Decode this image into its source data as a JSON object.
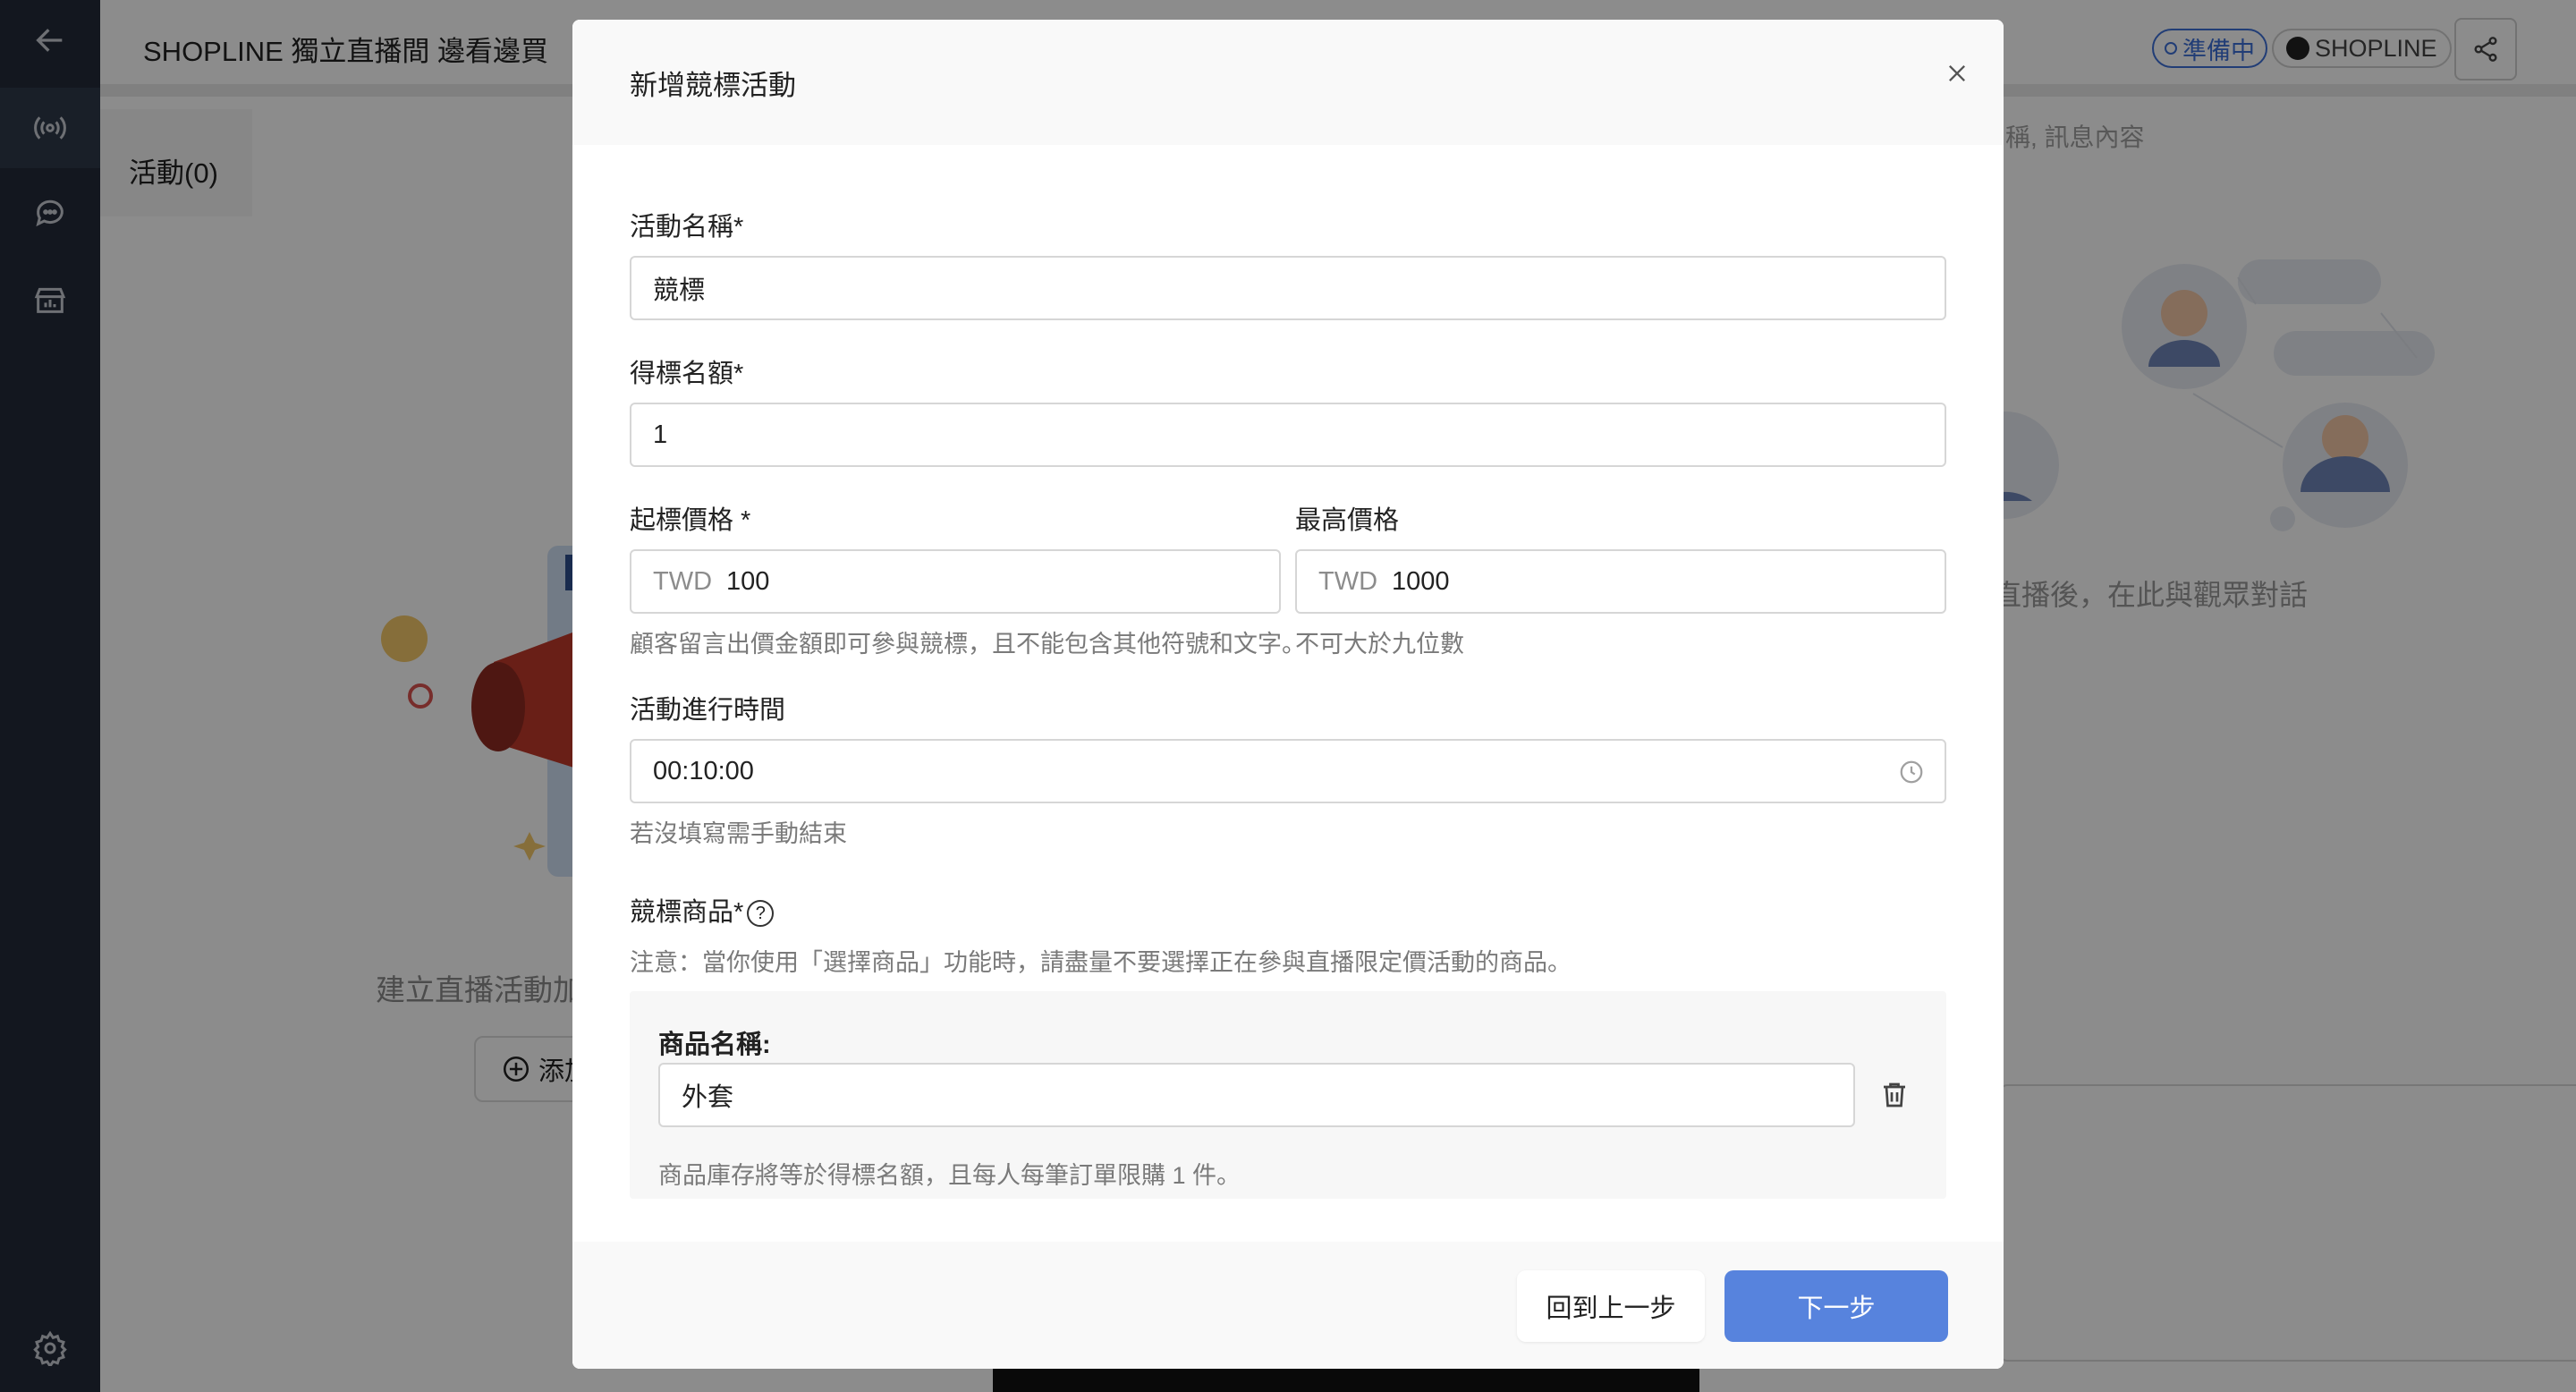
{
  "topbar": {
    "title": "SHOPLINE 獨立直播間  邊看邊買",
    "status_badge": "準備中",
    "brand_badge": "SHOPLINE"
  },
  "sidebar": {
    "items": [
      {
        "icon": "arrow-left-icon"
      },
      {
        "icon": "broadcast-icon"
      },
      {
        "icon": "chat-bubble-icon"
      },
      {
        "icon": "shop-stats-icon"
      },
      {
        "icon": "gear-icon"
      }
    ]
  },
  "background": {
    "activity_tab": "活動(0)",
    "search_hint": "稱, 訊息內容",
    "chat_hint": "直播後，在此與觀眾對話",
    "create_hint": "建立直播活動加",
    "add_button": "添加"
  },
  "modal": {
    "title": "新增競標活動",
    "fields": {
      "activity_name": {
        "label": "活動名稱*",
        "value": "競標"
      },
      "winner_quota": {
        "label": "得標名額*",
        "value": "1"
      },
      "start_price": {
        "label": "起標價格 *",
        "currency": "TWD",
        "value": "100",
        "hint": "顧客留言出價金額即可參與競標，且不能包含其他符號和文字。"
      },
      "max_price": {
        "label": "最高價格",
        "currency": "TWD",
        "value": "1000",
        "hint": "不可大於九位數"
      },
      "duration": {
        "label": "活動進行時間",
        "value": "00:10:00",
        "hint": "若沒填寫需手動結束"
      },
      "product": {
        "label": "競標商品*",
        "help": "?",
        "notice": "注意：當你使用「選擇商品」功能時，請盡量不要選擇正在參與直播限定價活動的商品。",
        "name_label": "商品名稱:",
        "name_value": "外套",
        "stock_hint": "商品庫存將等於得標名額，且每人每筆訂單限購 1 件。"
      }
    },
    "buttons": {
      "back": "回到上一步",
      "next": "下一步"
    }
  },
  "colors": {
    "sidebar": "#232b3a",
    "primary_button": "#5783dd",
    "status_blue": "#3d6fd8"
  }
}
